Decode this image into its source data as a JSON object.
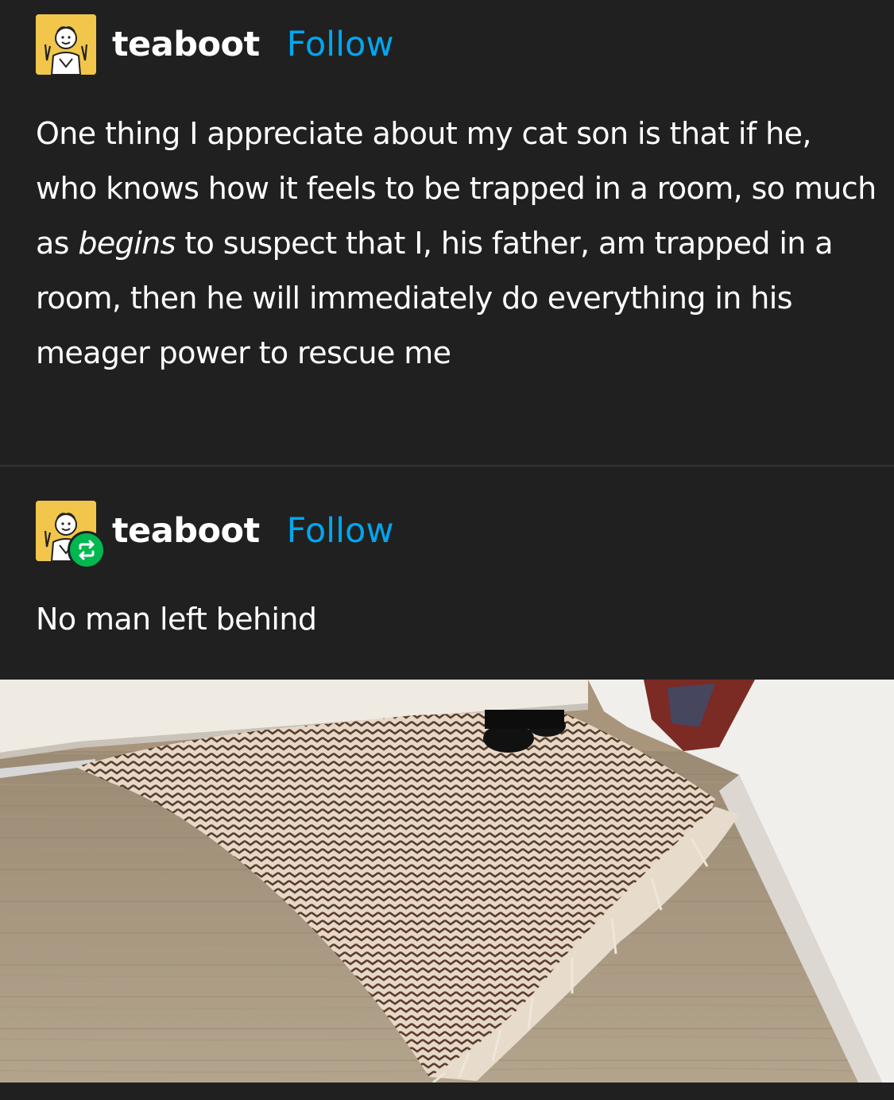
{
  "posts": [
    {
      "author": {
        "username": "teaboot",
        "follow_label": "Follow",
        "avatar_icon": "avatar-cartoon-icon",
        "avatar_color": "#f2c64b"
      },
      "text": {
        "before": "One thing I appreciate about my cat son is that if he, who knows how it feels to be trapped in a room, so much as ",
        "emphasis": "begins",
        "after": " to suspect that I, his father, am trapped in a room, then he will immediately do everything in his meager power to rescue me"
      }
    },
    {
      "author": {
        "username": "teaboot",
        "follow_label": "Follow",
        "avatar_icon": "avatar-cartoon-icon",
        "avatar_color": "#f2c64b",
        "badge_icon": "reblog-icon",
        "badge_color": "#00b84f"
      },
      "text": "No man left behind",
      "image": {
        "icon": "photo-cat-paws-under-door-on-rug"
      }
    }
  ],
  "colors": {
    "background": "#202020",
    "text": "#ffffff",
    "follow": "#00a7ef",
    "divider": "#333333"
  }
}
